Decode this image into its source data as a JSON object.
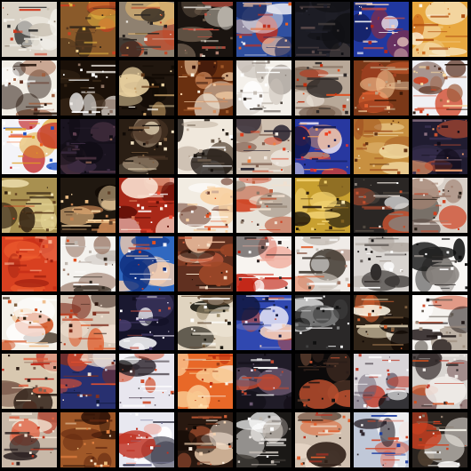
{
  "grid": {
    "rows": 8,
    "cols": 8,
    "border_color": "#000000",
    "tiles": [
      {
        "bg": "#d9d2c6",
        "palette": [
          "#f2efe9",
          "#c9c1b2",
          "#8a7b6a",
          "#cf3a1f",
          "#2a2a2a"
        ]
      },
      {
        "bg": "#8a5a2a",
        "palette": [
          "#e0b040",
          "#c84020",
          "#3a2a1a",
          "#f0d090",
          "#5a3a20"
        ]
      },
      {
        "bg": "#8f8170",
        "palette": [
          "#e8e4dc",
          "#4a4038",
          "#c04a2a",
          "#f0c070",
          "#2a2420"
        ]
      },
      {
        "bg": "#1a1410",
        "palette": [
          "#d8d0c0",
          "#b08070",
          "#f0ece4",
          "#6a5a4a",
          "#c05040"
        ]
      },
      {
        "bg": "#3050a0",
        "palette": [
          "#f06020",
          "#f0c0a0",
          "#1a2a60",
          "#e8e8f0",
          "#c03020"
        ]
      },
      {
        "bg": "#1c1c24",
        "palette": [
          "#2a2a34",
          "#403a3a",
          "#101014",
          "#5a4a4a",
          "#20202a"
        ]
      },
      {
        "bg": "#2038a0",
        "palette": [
          "#e85030",
          "#f0d0c0",
          "#101a50",
          "#ffffff",
          "#b02820"
        ]
      },
      {
        "bg": "#e8a840",
        "palette": [
          "#f8e8c8",
          "#d07020",
          "#fff4e0",
          "#b05010",
          "#f0c880"
        ]
      },
      {
        "bg": "#f2eee6",
        "palette": [
          "#2a1a10",
          "#a06040",
          "#d0c0b0",
          "#ffffff",
          "#603020"
        ]
      },
      {
        "bg": "#1a1008",
        "palette": [
          "#f0ece8",
          "#8a7060",
          "#d0c8c0",
          "#3a2818",
          "#ffffff"
        ]
      },
      {
        "bg": "#20160e",
        "palette": [
          "#f8f4e8",
          "#c8a068",
          "#603818",
          "#e8d0a0",
          "#100a04"
        ]
      },
      {
        "bg": "#6a3010",
        "palette": [
          "#f8f0e0",
          "#d89060",
          "#301008",
          "#f0c8a0",
          "#a05828"
        ]
      },
      {
        "bg": "#f4f0ea",
        "palette": [
          "#2a2420",
          "#8a8078",
          "#c8c0b8",
          "#ffffff",
          "#504840"
        ]
      },
      {
        "bg": "#b8a898",
        "palette": [
          "#e05020",
          "#302a28",
          "#f0e8e0",
          "#705848",
          "#c03010"
        ]
      },
      {
        "bg": "#7a3818",
        "palette": [
          "#e06030",
          "#f0c090",
          "#3a1808",
          "#c0a080",
          "#a04020"
        ]
      },
      {
        "bg": "#f0f0f4",
        "palette": [
          "#d04020",
          "#5a3020",
          "#f8d8a0",
          "#2a1a10",
          "#a06040"
        ]
      },
      {
        "bg": "#f4f4f8",
        "palette": [
          "#2050c0",
          "#f06020",
          "#e0a020",
          "#ffffff",
          "#c02020"
        ]
      },
      {
        "bg": "#1a1420",
        "palette": [
          "#3a2a40",
          "#8a6050",
          "#2a2030",
          "#604050",
          "#100c14"
        ]
      },
      {
        "bg": "#2a1e14",
        "palette": [
          "#d8c0a0",
          "#100a06",
          "#806040",
          "#f0e0c0",
          "#503828"
        ]
      },
      {
        "bg": "#f0e8dc",
        "palette": [
          "#1a1410",
          "#6a5a4a",
          "#c0b0a0",
          "#ffffff",
          "#302820"
        ]
      },
      {
        "bg": "#d0c0b0",
        "palette": [
          "#e04020",
          "#2a2430",
          "#f0e8e0",
          "#806050",
          "#f08040"
        ]
      },
      {
        "bg": "#2838a0",
        "palette": [
          "#f04020",
          "#e8e0f0",
          "#101850",
          "#c83040",
          "#f0a060"
        ]
      },
      {
        "bg": "#c89040",
        "palette": [
          "#f0d8a0",
          "#a05020",
          "#e8c080",
          "#603010",
          "#f8e8c0"
        ]
      },
      {
        "bg": "#201c30",
        "palette": [
          "#c85030",
          "#8a7080",
          "#3a3050",
          "#f0a070",
          "#100c18"
        ]
      },
      {
        "bg": "#a89050",
        "palette": [
          "#e0d090",
          "#d04020",
          "#604020",
          "#f0e0b0",
          "#302010"
        ]
      },
      {
        "bg": "#201810",
        "palette": [
          "#c08050",
          "#f0d0a0",
          "#604028",
          "#e8b880",
          "#100804"
        ]
      },
      {
        "bg": "#a82818",
        "palette": [
          "#f04830",
          "#f8e0d0",
          "#601008",
          "#ffffff",
          "#d07050"
        ]
      },
      {
        "bg": "#f2ece2",
        "palette": [
          "#e05020",
          "#c0a090",
          "#f8d0a0",
          "#704030",
          "#ffffff"
        ]
      },
      {
        "bg": "#e8e2d8",
        "palette": [
          "#c06040",
          "#8a7868",
          "#f0e0d0",
          "#504038",
          "#d04020"
        ]
      },
      {
        "bg": "#c8a030",
        "palette": [
          "#f0d070",
          "#1a140c",
          "#806020",
          "#f8e8b0",
          "#302010"
        ]
      },
      {
        "bg": "#2a2624",
        "palette": [
          "#e8e0d8",
          "#8a8078",
          "#c05030",
          "#ffffff",
          "#504840"
        ]
      },
      {
        "bg": "#d8d0c8",
        "palette": [
          "#201810",
          "#d04020",
          "#605048",
          "#f0e8e0",
          "#a08070"
        ]
      },
      {
        "bg": "#d84020",
        "palette": [
          "#f06030",
          "#f8b090",
          "#a02010",
          "#e87050",
          "#c83018"
        ]
      },
      {
        "bg": "#f4f2ee",
        "palette": [
          "#e05020",
          "#c0b8b0",
          "#a08070",
          "#ffffff",
          "#302820"
        ]
      },
      {
        "bg": "#3068c0",
        "palette": [
          "#f0f0f8",
          "#e05020",
          "#103080",
          "#f8d0b0",
          "#c04030"
        ]
      },
      {
        "bg": "#603020",
        "palette": [
          "#d06040",
          "#f0c0a0",
          "#201008",
          "#a04828",
          "#f8e0c8"
        ]
      },
      {
        "bg": "#f8f4f0",
        "palette": [
          "#c02010",
          "#e08070",
          "#302828",
          "#ffffff",
          "#f0b0a0"
        ]
      },
      {
        "bg": "#f0ece8",
        "palette": [
          "#e06030",
          "#c8c0b8",
          "#a07868",
          "#ffffff",
          "#403830"
        ]
      },
      {
        "bg": "#d8d4d0",
        "palette": [
          "#1a1818",
          "#ffffff",
          "#6a6460",
          "#b0a8a0",
          "#302c2a"
        ]
      },
      {
        "bg": "#f8f6f4",
        "palette": [
          "#101010",
          "#3a3634",
          "#ffffff",
          "#8a8480",
          "#202020"
        ]
      },
      {
        "bg": "#f4f0e8",
        "palette": [
          "#d05020",
          "#302010",
          "#f0c090",
          "#ffffff",
          "#806040"
        ]
      },
      {
        "bg": "#d8c8b8",
        "palette": [
          "#c03818",
          "#301810",
          "#f0e0d0",
          "#803020",
          "#e06030"
        ]
      },
      {
        "bg": "#1a1830",
        "palette": [
          "#e8e0f0",
          "#4a4070",
          "#c05040",
          "#ffffff",
          "#100e20"
        ]
      },
      {
        "bg": "#e0d4c0",
        "palette": [
          "#f0e8d8",
          "#1a1810",
          "#a09070",
          "#ffffff",
          "#604830"
        ]
      },
      {
        "bg": "#3048b0",
        "palette": [
          "#e8e8f8",
          "#101840",
          "#d05030",
          "#6070c0",
          "#f0d0c0"
        ]
      },
      {
        "bg": "#2a2828",
        "palette": [
          "#f0f0f0",
          "#101010",
          "#808080",
          "#ffffff",
          "#404040"
        ]
      },
      {
        "bg": "#302418",
        "palette": [
          "#e8d8b8",
          "#d06030",
          "#806040",
          "#f8f0e0",
          "#100804"
        ]
      },
      {
        "bg": "#f4f2ee",
        "palette": [
          "#201818",
          "#d05030",
          "#605850",
          "#ffffff",
          "#a09080"
        ]
      },
      {
        "bg": "#d8c8b0",
        "palette": [
          "#c03020",
          "#302018",
          "#f0e0c8",
          "#806050",
          "#e06040"
        ]
      },
      {
        "bg": "#283070",
        "palette": [
          "#e05030",
          "#f0e0d0",
          "#101838",
          "#c0c8e0",
          "#803020"
        ]
      },
      {
        "bg": "#e8e6ee",
        "palette": [
          "#101010",
          "#d05030",
          "#6a6070",
          "#ffffff",
          "#302830"
        ]
      },
      {
        "bg": "#e86828",
        "palette": [
          "#f8c890",
          "#f8f0e0",
          "#c03010",
          "#ffe0b0",
          "#a04018"
        ]
      },
      {
        "bg": "#201c28",
        "palette": [
          "#e0d8e8",
          "#6a5870",
          "#c04830",
          "#ffffff",
          "#100c14"
        ]
      },
      {
        "bg": "#0c0a0a",
        "palette": [
          "#2a1c18",
          "#604030",
          "#101010",
          "#c05030",
          "#201818"
        ]
      },
      {
        "bg": "#d8d4d8",
        "palette": [
          "#101014",
          "#6a6070",
          "#c04030",
          "#ffffff",
          "#302830"
        ]
      },
      {
        "bg": "#d8d4d0",
        "palette": [
          "#d05020",
          "#302828",
          "#f0ece8",
          "#806060",
          "#c04030"
        ]
      },
      {
        "bg": "#c8b8a8",
        "palette": [
          "#c03820",
          "#2a2020",
          "#f0e0d0",
          "#706050",
          "#e06040"
        ]
      },
      {
        "bg": "#a05828",
        "palette": [
          "#f0c080",
          "#602810",
          "#e08040",
          "#f8e0c0",
          "#301408"
        ]
      },
      {
        "bg": "#e8e8f0",
        "palette": [
          "#c03020",
          "#8080a0",
          "#ffffff",
          "#303040",
          "#f0a090"
        ]
      },
      {
        "bg": "#281810",
        "palette": [
          "#d06038",
          "#f0d0b0",
          "#100804",
          "#804028",
          "#f8e8d8"
        ]
      },
      {
        "bg": "#1a1816",
        "palette": [
          "#f0ece8",
          "#8a8480",
          "#ffffff",
          "#403c38",
          "#c0b8b0"
        ]
      },
      {
        "bg": "#d0c0b0",
        "palette": [
          "#c03020",
          "#f0e0d0",
          "#302018",
          "#e06030",
          "#806050"
        ]
      },
      {
        "bg": "#c0c8d8",
        "palette": [
          "#d04020",
          "#f8f8f8",
          "#302830",
          "#e08070",
          "#2040a0"
        ]
      },
      {
        "bg": "#2a2420",
        "palette": [
          "#f0ece4",
          "#8a7868",
          "#d04020",
          "#ffffff",
          "#504030"
        ]
      }
    ]
  }
}
